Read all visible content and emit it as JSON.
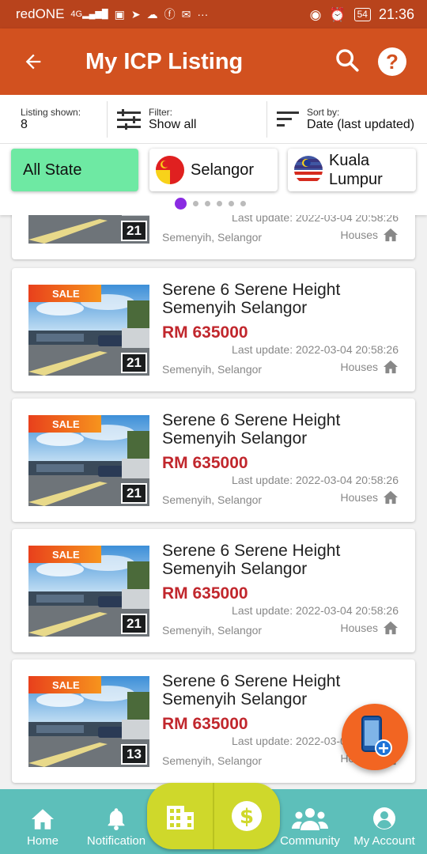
{
  "status_bar": {
    "carrier": "redONE",
    "network": "4G",
    "battery": "54",
    "time": "21:36"
  },
  "app_bar": {
    "title": "My ICP Listing"
  },
  "filter_bar": {
    "shown_label": "Listing shown:",
    "shown_value": "8",
    "filter_label": "Filter:",
    "filter_value": "Show all",
    "sort_label": "Sort by:",
    "sort_value": "Date (last updated)"
  },
  "states": [
    {
      "label": "All State"
    },
    {
      "label": "Selangor"
    },
    {
      "label": "Kuala Lumpur"
    }
  ],
  "listings": [
    {
      "title": "",
      "price": "",
      "updated": "Last update: 2022-03-04 20:58:26",
      "location": "Semenyih, Selangor",
      "type": "Houses",
      "photos": "21",
      "badge": ""
    },
    {
      "title": "Serene 6 Serene Height Semenyih Selangor",
      "price": "RM 635000",
      "updated": "Last update: 2022-03-04 20:58:26",
      "location": "Semenyih, Selangor",
      "type": "Houses",
      "photos": "21",
      "badge": "SALE"
    },
    {
      "title": "Serene 6 Serene Height Semenyih Selangor",
      "price": "RM 635000",
      "updated": "Last update: 2022-03-04 20:58:26",
      "location": "Semenyih, Selangor",
      "type": "Houses",
      "photos": "21",
      "badge": "SALE"
    },
    {
      "title": "Serene 6 Serene Height Semenyih Selangor",
      "price": "RM 635000",
      "updated": "Last update: 2022-03-04 20:58:26",
      "location": "Semenyih, Selangor",
      "type": "Houses",
      "photos": "21",
      "badge": "SALE"
    },
    {
      "title": "Serene 6 Serene Height Semenyih Selangor",
      "price": "RM 635000",
      "updated": "Last update: 2022-03-04 20:58:26",
      "location": "Semenyih, Selangor",
      "type": "Houses",
      "photos": "13",
      "badge": "SALE"
    }
  ],
  "bottom_nav": {
    "home": "Home",
    "notification": "Notification",
    "community": "Community",
    "account": "My Account"
  },
  "colors": {
    "status_bar": "#b8431c",
    "app_bar": "#d2511f",
    "active_state_chip": "#6ee9a3",
    "price": "#c1272d",
    "fab": "#f26522",
    "bottom_nav": "#5dbfba",
    "center_pill": "#cfd82b"
  }
}
